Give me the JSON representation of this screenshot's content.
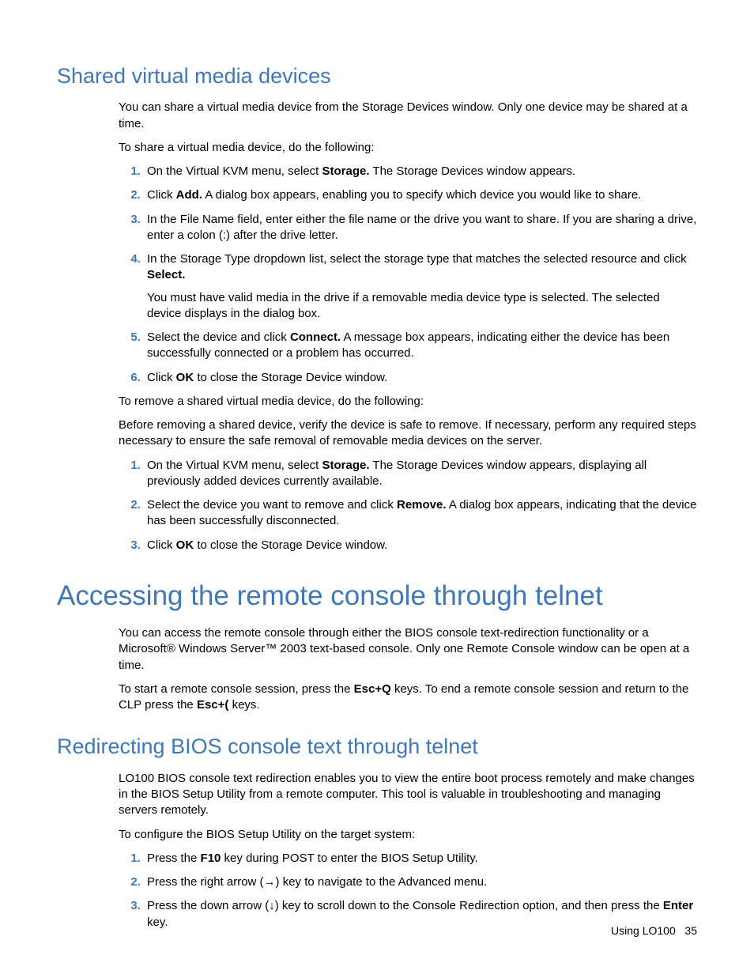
{
  "section1": {
    "heading": "Shared virtual media devices",
    "intro": "You can share a virtual media device from the Storage Devices window. Only one device may be shared at a time.",
    "lead1": "To share a virtual media device, do the following:",
    "steps1": {
      "s1a": "On the Virtual KVM menu, select ",
      "s1b": "Storage.",
      "s1c": " The Storage Devices window appears.",
      "s2a": "Click ",
      "s2b": "Add.",
      "s2c": " A dialog box appears, enabling you to specify which device you would like to share.",
      "s3": "In the File Name field, enter either the file name or the drive you want to share. If you are sharing a drive, enter a colon (:) after the drive letter.",
      "s4a": "In the Storage Type dropdown list, select the storage type that matches the selected resource and click ",
      "s4b": "Select.",
      "s4note": "You must have valid media in the drive if a removable media device type is selected. The selected device displays in the dialog box.",
      "s5a": "Select the device and click ",
      "s5b": "Connect.",
      "s5c": " A message box appears, indicating either the device has been successfully connected or a problem has occurred.",
      "s6a": "Click ",
      "s6b": "OK",
      "s6c": " to close the Storage Device window."
    },
    "lead2": "To remove a shared virtual media device, do the following:",
    "note2": "Before removing a shared device, verify the device is safe to remove. If necessary, perform any required steps necessary to ensure the safe removal of removable media devices on the server.",
    "steps2": {
      "s1a": "On the Virtual KVM menu, select ",
      "s1b": "Storage.",
      "s1c": " The Storage Devices window appears, displaying all previously added devices currently available.",
      "s2a": "Select the device you want to remove and click ",
      "s2b": "Remove.",
      "s2c": " A dialog box appears, indicating that the device has been successfully disconnected.",
      "s3a": "Click ",
      "s3b": "OK",
      "s3c": " to close the Storage Device window."
    }
  },
  "section2": {
    "heading": "Accessing the remote console through telnet",
    "p1": "You can access the remote console through either the BIOS console text-redirection functionality or a Microsoft® Windows Server™ 2003 text-based console. Only one Remote Console window can be open at a time.",
    "p2a": "To start a remote console session, press the ",
    "p2b": "Esc+Q",
    "p2c": " keys. To end a remote console session and return to the CLP press the ",
    "p2d": "Esc+(",
    "p2e": " keys."
  },
  "section3": {
    "heading": "Redirecting BIOS console text through telnet",
    "p1": "LO100 BIOS console text redirection enables you to view the entire boot process remotely and make changes in the BIOS Setup Utility from a remote computer. This tool is valuable in troubleshooting and managing servers remotely.",
    "lead": "To configure the BIOS Setup Utility on the target system:",
    "steps": {
      "s1a": "Press the ",
      "s1b": "F10",
      "s1c": " key during POST to enter the BIOS Setup Utility.",
      "s2": "Press the right arrow (→) key to navigate to the Advanced menu.",
      "s3a": "Press the down arrow (↓) key to scroll down to the Console Redirection option, and then press the ",
      "s3b": "Enter",
      "s3c": " key."
    }
  },
  "footer": {
    "label": "Using LO100",
    "page": "35"
  }
}
